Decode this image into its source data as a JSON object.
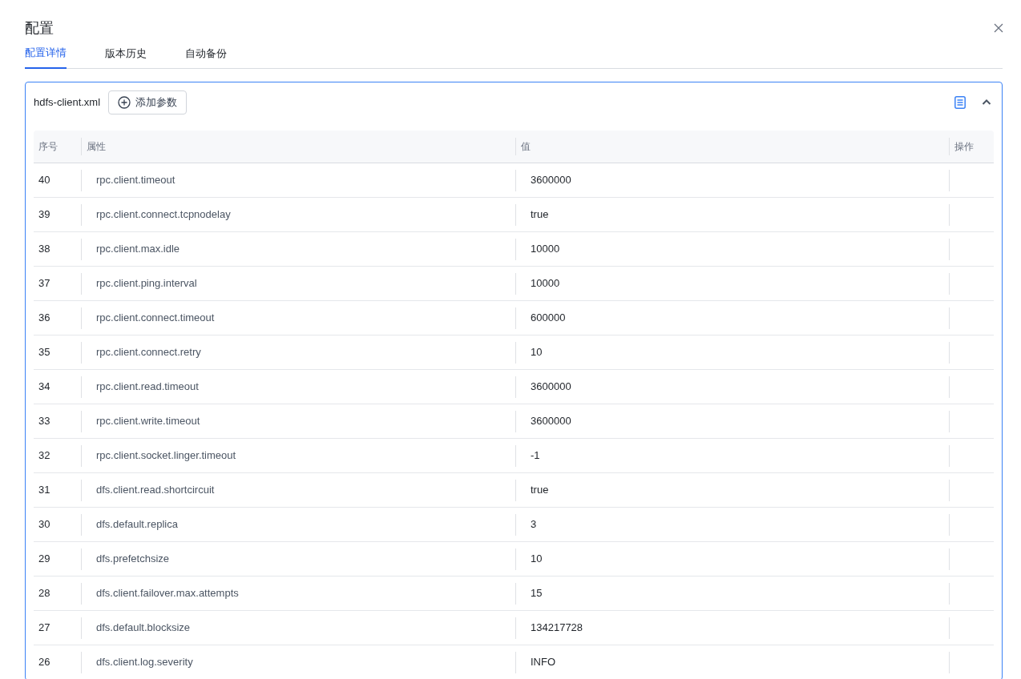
{
  "title": "配置",
  "tabs": [
    {
      "label": "配置详情",
      "selected": true
    },
    {
      "label": "版本历史",
      "selected": false
    },
    {
      "label": "自动备份",
      "selected": false
    }
  ],
  "panel": {
    "file_name": "hdfs-client.xml",
    "add_button": "添加参数",
    "expanded": true
  },
  "table": {
    "columns": [
      "序号",
      "属性",
      "值",
      "操作"
    ],
    "rows": [
      {
        "index": "40",
        "property": "rpc.client.timeout",
        "value": "3600000"
      },
      {
        "index": "39",
        "property": "rpc.client.connect.tcpnodelay",
        "value": "true"
      },
      {
        "index": "38",
        "property": "rpc.client.max.idle",
        "value": "10000"
      },
      {
        "index": "37",
        "property": "rpc.client.ping.interval",
        "value": "10000"
      },
      {
        "index": "36",
        "property": "rpc.client.connect.timeout",
        "value": "600000"
      },
      {
        "index": "35",
        "property": "rpc.client.connect.retry",
        "value": "10"
      },
      {
        "index": "34",
        "property": "rpc.client.read.timeout",
        "value": "3600000"
      },
      {
        "index": "33",
        "property": "rpc.client.write.timeout",
        "value": "3600000"
      },
      {
        "index": "32",
        "property": "rpc.client.socket.linger.timeout",
        "value": "-1"
      },
      {
        "index": "31",
        "property": "dfs.client.read.shortcircuit",
        "value": "true"
      },
      {
        "index": "30",
        "property": "dfs.default.replica",
        "value": "3"
      },
      {
        "index": "29",
        "property": "dfs.prefetchsize",
        "value": "10"
      },
      {
        "index": "28",
        "property": "dfs.client.failover.max.attempts",
        "value": "15"
      },
      {
        "index": "27",
        "property": "dfs.default.blocksize",
        "value": "134217728"
      },
      {
        "index": "26",
        "property": "dfs.client.log.severity",
        "value": "INFO"
      }
    ]
  }
}
